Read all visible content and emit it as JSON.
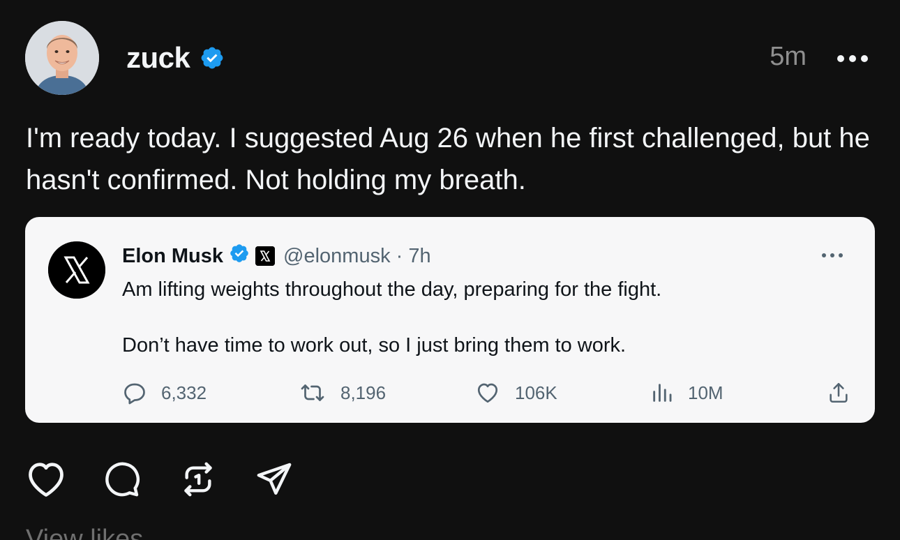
{
  "post": {
    "username": "zuck",
    "verified": true,
    "timestamp": "5m",
    "text": "I'm ready today. I suggested Aug 26 when he first challenged, but he hasn't confirmed. Not holding my breath.",
    "view_likes_label": "View likes"
  },
  "embedded_tweet": {
    "author": "Elon Musk",
    "verified": true,
    "handle_time": "@elonmusk · 7h",
    "body_line1": "Am lifting weights throughout the day, preparing for the fight.",
    "body_line2": "Don’t have time to work out, so I just bring them to work.",
    "stats": {
      "replies": "6,332",
      "reposts": "8,196",
      "likes": "106K",
      "views": "10M"
    }
  },
  "icons": {
    "avatar": "avatar",
    "verified": "verified-badge-icon",
    "more": "more-horizontal-icon",
    "x_logo": "x-logo-icon",
    "reply": "reply-icon",
    "repost": "repost-icon",
    "like": "heart-icon",
    "views": "views-chart-icon",
    "share": "share-icon",
    "comment": "comment-icon",
    "send": "send-icon"
  },
  "colors": {
    "background": "#101010",
    "text_primary": "#f3f5f7",
    "text_secondary": "#8f8f8f",
    "verified_blue": "#1d9bf0",
    "card_bg": "#f7f7f8"
  }
}
